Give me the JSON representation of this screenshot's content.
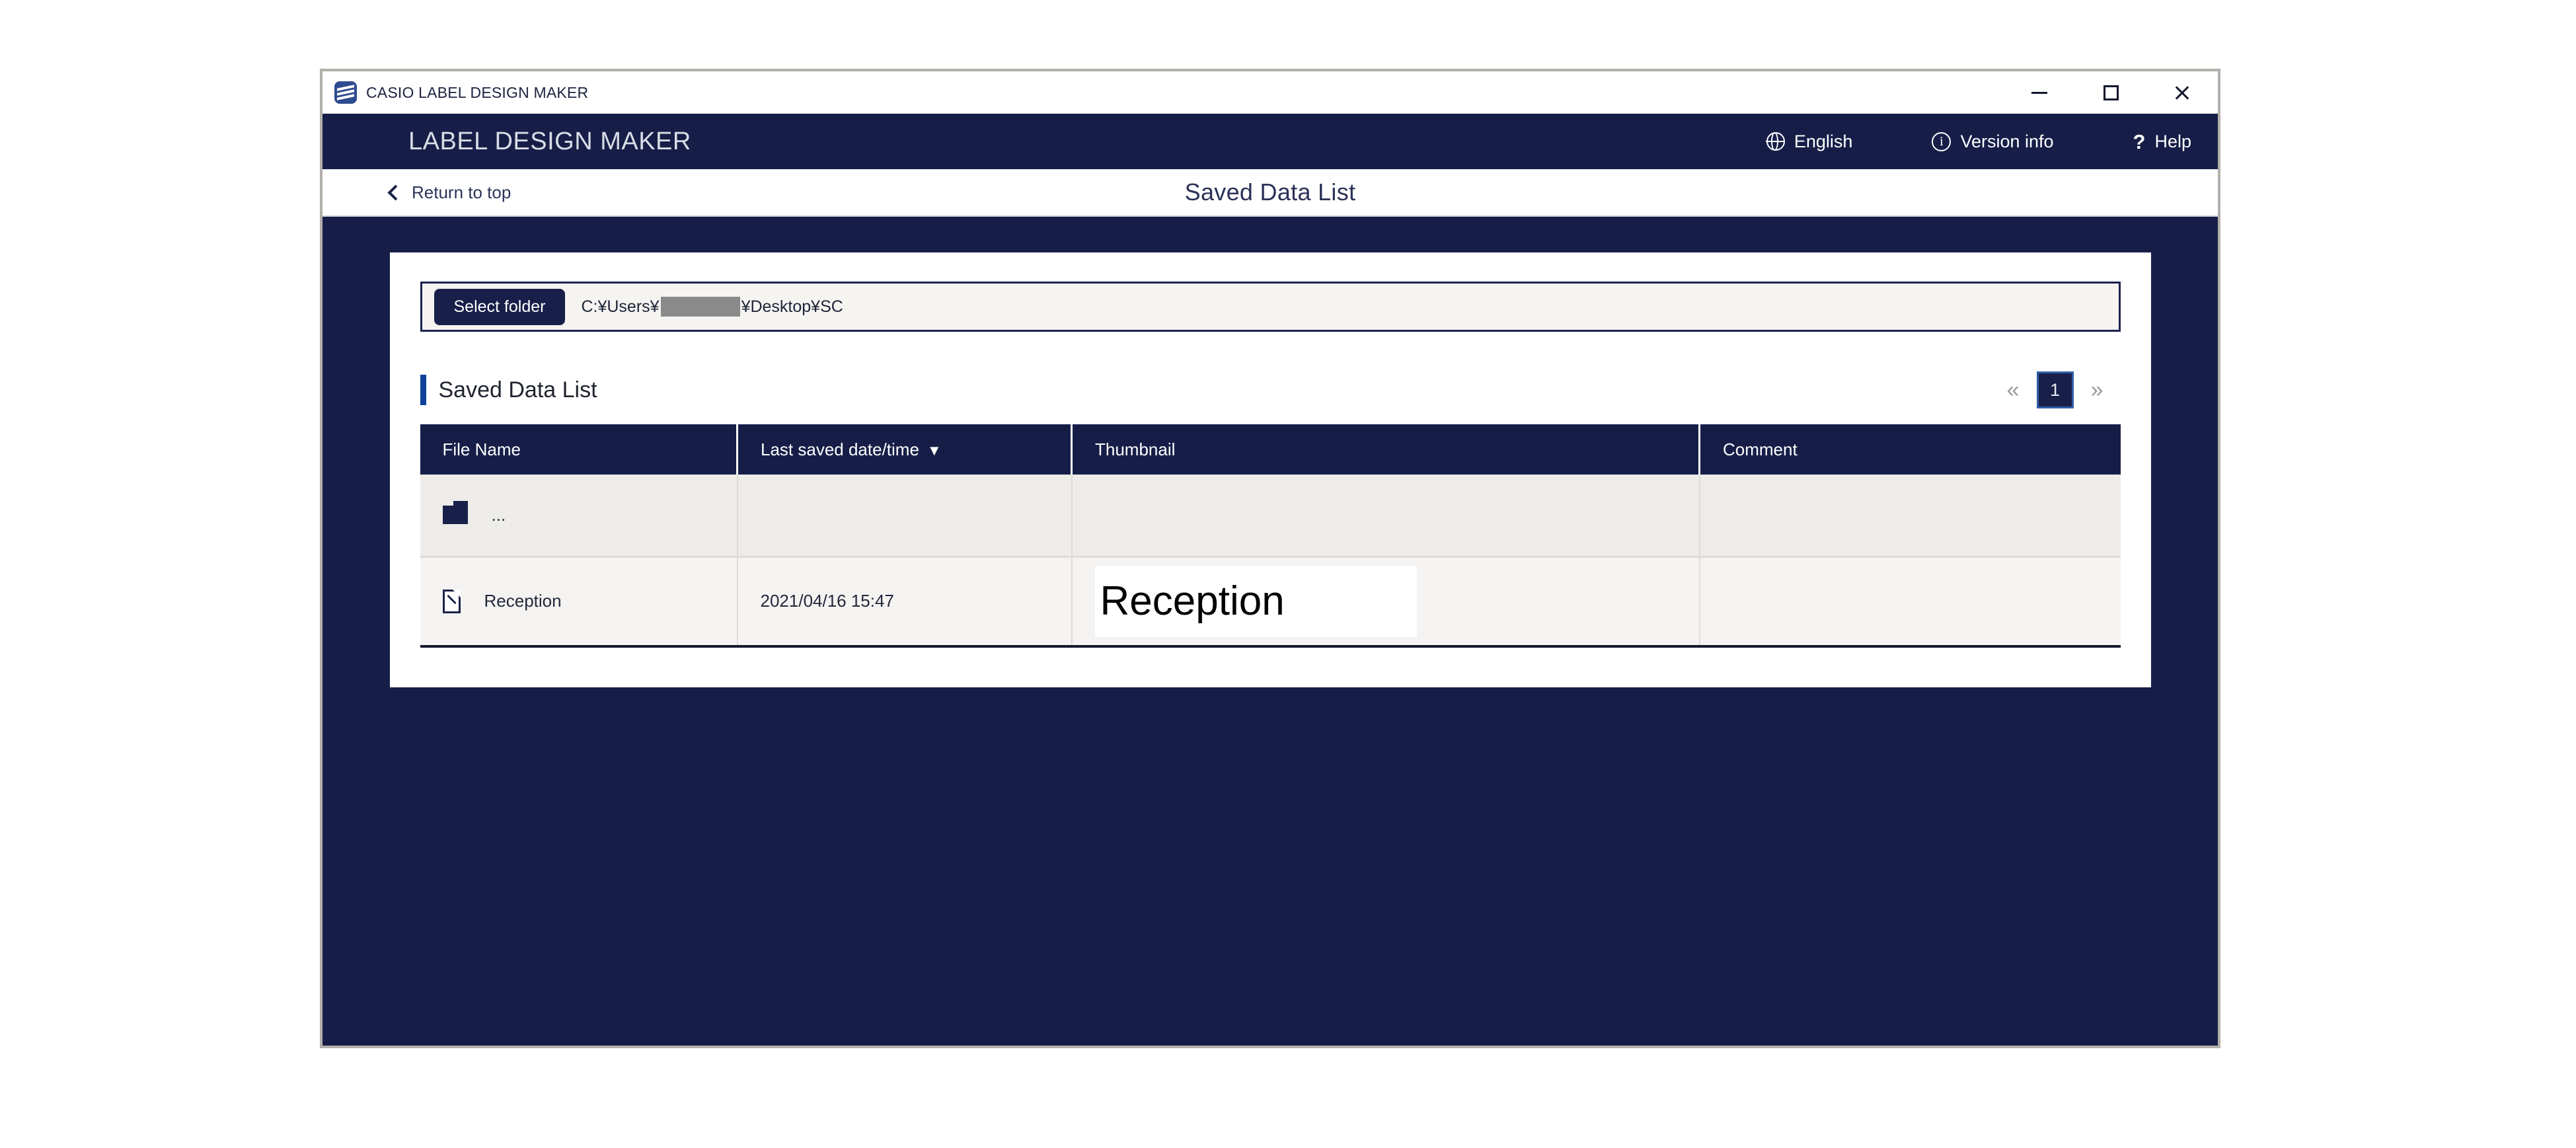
{
  "window": {
    "title": "CASIO LABEL DESIGN MAKER",
    "icon": "casio-logo-icon",
    "controls": {
      "minimize": "minimize-icon",
      "maximize": "maximize-icon",
      "close": "close-icon"
    }
  },
  "brand_header": {
    "title": "LABEL DESIGN MAKER",
    "menu": [
      {
        "icon": "globe-icon",
        "label": "English"
      },
      {
        "icon": "info-circle-icon",
        "label": "Version info"
      },
      {
        "icon": "question-mark-icon",
        "label": "Help"
      }
    ]
  },
  "sub_header": {
    "back_label": "Return to top",
    "back_icon": "chevron-left-icon",
    "page_title": "Saved Data List"
  },
  "folder_bar": {
    "button_label": "Select folder",
    "path_prefix": "C:¥Users¥",
    "path_suffix": "¥Desktop¥SC",
    "redacted": true
  },
  "list_section": {
    "title": "Saved Data List",
    "accent_color": "#10409c",
    "pagination": {
      "prev_label": "«",
      "next_label": "»",
      "current_page": "1"
    }
  },
  "table": {
    "columns": [
      {
        "label": "File Name",
        "sort": ""
      },
      {
        "label": "Last saved date/time",
        "sort": "▼"
      },
      {
        "label": "Thumbnail",
        "sort": ""
      },
      {
        "label": "Comment",
        "sort": ""
      }
    ],
    "rows": [
      {
        "icon": "folder-icon",
        "name": "...",
        "date": "",
        "thumbnail": "",
        "comment": ""
      },
      {
        "icon": "file-icon",
        "name": "Reception",
        "date": "2021/04/16 15:47",
        "thumbnail": "Reception",
        "comment": ""
      }
    ]
  },
  "colors": {
    "navy": "#161e48",
    "accent_blue": "#10409c",
    "page_active": "#181f49",
    "row_alt": "#edece9",
    "row_base": "#f4f3f1"
  }
}
